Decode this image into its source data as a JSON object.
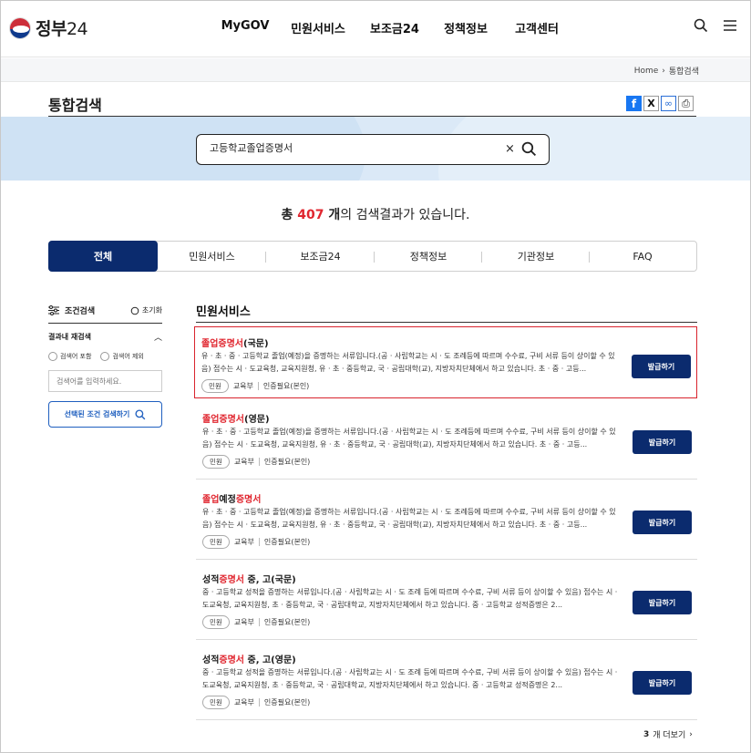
{
  "header": {
    "logo_text": "정부",
    "logo_num": "24",
    "nav": [
      "MyGOV",
      "민원서비스",
      "보조금24",
      "정책정보",
      "고객센터"
    ]
  },
  "breadcrumb": {
    "home": "Home",
    "current": "통합검색"
  },
  "page_title": "통합검색",
  "search": {
    "value": "고등학교졸업증명서"
  },
  "result_count": {
    "prefix": "총 ",
    "count": "407",
    "unit": " 개",
    "suffix": "의 검색결과가 있습니다."
  },
  "tabs": [
    "전체",
    "민원서비스",
    "보조금24",
    "정책정보",
    "기관정보",
    "FAQ"
  ],
  "filter": {
    "title": "조건검색",
    "reset": "초기화",
    "subtitle": "결과내 재검색",
    "radio_include": "검색어 포함",
    "radio_exclude": "검색어 제외",
    "input_placeholder": "검색어를 입력하세요.",
    "button": "선택된 조건 검색하기"
  },
  "section_title": "민원서비스",
  "results": [
    {
      "title_hl": "졸업증명서",
      "title_rest": "(국문)",
      "desc": "유 · 초 · 중 · 고등학교 졸업(예정)을 증명하는 서류입니다.(공 · 사립학교는 시 · 도 조례등에 따르며 수수료, 구비 서류 등이 상이할 수 있음) 접수는 시 · 도교육청, 교육지원청, 유 · 초 · 중등학교, 국 · 공립대학(교), 지방자치단체에서 하고 있습니다. 초 · 중 · 고등...",
      "badge": "민원",
      "org": "교육부",
      "auth": "인증필요(본인)",
      "button": "발급하기"
    },
    {
      "title_hl": "졸업증명서",
      "title_rest": "(영문)",
      "desc": "유 · 초 · 중 · 고등학교 졸업(예정)을 증명하는 서류입니다.(공 · 사립학교는 시 · 도 조례등에 따르며 수수료, 구비 서류 등이 상이할 수 있음) 접수는 시 · 도교육청, 교육지원청, 유 · 초 · 중등학교, 국 · 공립대학(교), 지방자치단체에서 하고 있습니다. 초 · 중 · 고등...",
      "badge": "민원",
      "org": "교육부",
      "auth": "인증필요(본인)",
      "button": "발급하기"
    },
    {
      "title_pre": "",
      "title_hl": "졸업",
      "title_mid": "예정",
      "title_hl2": "증명서",
      "desc": "유 · 초 · 중 · 고등학교 졸업(예정)을 증명하는 서류입니다.(공 · 사립학교는 시 · 도 조례등에 따르며 수수료, 구비 서류 등이 상이할 수 있음) 접수는 시 · 도교육청, 교육지원청, 유 · 초 · 중등학교, 국 · 공립대학(교), 지방자치단체에서 하고 있습니다. 초 · 중 · 고등...",
      "badge": "민원",
      "org": "교육부",
      "auth": "인증필요(본인)",
      "button": "발급하기"
    },
    {
      "title_pre": "성적",
      "title_hl": "증명서",
      "title_rest": " 중, 고(국문)",
      "desc": "중 · 고등학교 성적을 증명하는 서류입니다.(공 · 사립학교는 시 · 도 조례 등에 따르며 수수료, 구비 서류 등이 상이할 수 있음) 접수는 시 · 도교육청, 교육지원청, 초 · 중등학교, 국 · 공립대학교, 지방자치단체에서 하고 있습니다. 중 · 고등학교 성적증명은 2...",
      "badge": "민원",
      "org": "교육부",
      "auth": "인증필요(본인)",
      "button": "발급하기"
    },
    {
      "title_pre": "성적",
      "title_hl": "증명서",
      "title_rest": " 중, 고(영문)",
      "desc": "중 · 고등학교 성적을 증명하는 서류입니다.(공 · 사립학교는 시 · 도 조례 등에 따르며 수수료, 구비 서류 등이 상이할 수 있음) 접수는 시 · 도교육청, 교육지원청, 초 · 중등학교, 국 · 공립대학교, 지방자치단체에서 하고 있습니다. 중 · 고등학교 성적증명은 2...",
      "badge": "민원",
      "org": "교육부",
      "auth": "인증필요(본인)",
      "button": "발급하기"
    }
  ],
  "more": {
    "count": "3",
    "label": "개 더보기"
  }
}
